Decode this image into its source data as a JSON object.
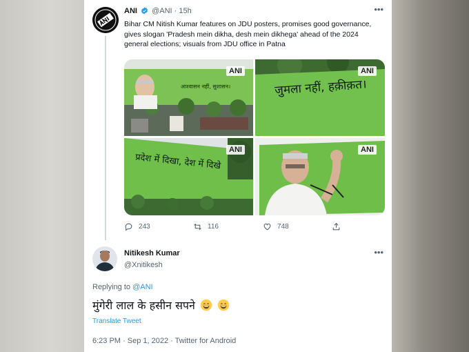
{
  "tweet": {
    "author_name": "ANI",
    "author_handle": "@ANI",
    "separator": "·",
    "time": "15h",
    "more_label": "•••",
    "text": "Bihar CM Nitish Kumar features on JDU posters, promises good governance, gives slogan 'Pradesh mein dikha, desh mein dikhega' ahead of the 2024 general elections; visuals from JDU office in Patna",
    "images": [
      {
        "watermark": "ANI",
        "poster_text": "आश्वासन नहीं, सुशासन।"
      },
      {
        "watermark": "ANI",
        "poster_text": "जुमला नहीं, हक़ीक़त।"
      },
      {
        "watermark": "ANI",
        "poster_text": "प्रदेश में दिखा, देश में दिखे"
      },
      {
        "watermark": "ANI",
        "poster_text": ""
      }
    ],
    "actions": {
      "replies": "243",
      "retweets": "116",
      "likes": "748"
    }
  },
  "reply": {
    "author_name": "Nitikesh Kumar",
    "author_handle": "@Xnitikesh",
    "more_label": "•••",
    "replying_prefix": "Replying to",
    "replying_to": "@ANI",
    "text": "मुंगेरी लाल के हसीन सपने",
    "emoji_count": 2,
    "translate_label": "Translate Tweet",
    "timestamp": "6:23 PM · Sep 1, 2022 · Twitter for Android"
  },
  "colors": {
    "accent": "#1d9bf0",
    "poster_green": "#6fbe4a",
    "text_primary": "#0f1419",
    "text_secondary": "#536471"
  },
  "icons": [
    "verified-badge-icon",
    "reply-icon",
    "retweet-icon",
    "like-icon",
    "share-icon",
    "more-icon",
    "grin-emoji-icon"
  ]
}
